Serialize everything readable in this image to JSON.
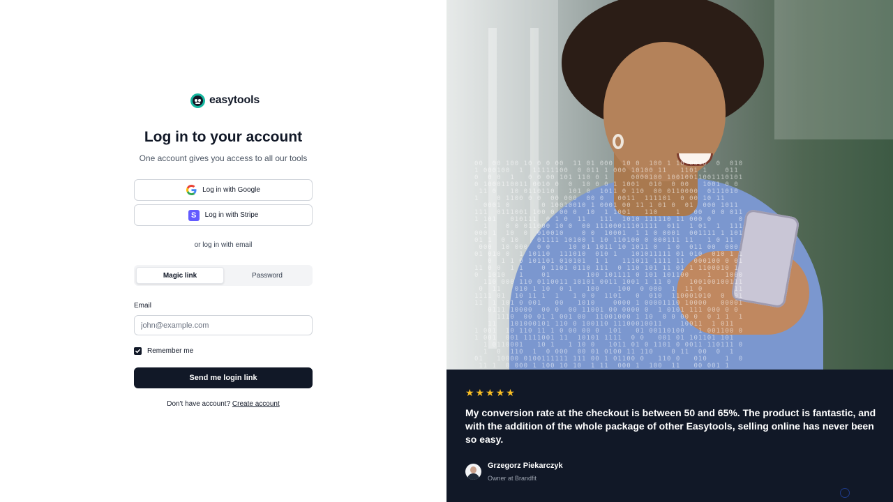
{
  "brand": {
    "name": "easytools",
    "accent": "#16b8a0"
  },
  "login": {
    "title": "Log in to your account",
    "subtitle": "One account gives you access to all our tools",
    "google_label": "Log in with Google",
    "stripe_label": "Log in with Stripe",
    "stripe_letter": "S",
    "divider": "or log in with email",
    "tabs": [
      {
        "label": "Magic link",
        "active": true
      },
      {
        "label": "Password",
        "active": false
      }
    ],
    "email_label": "Email",
    "email_placeholder": "john@example.com",
    "email_value": "",
    "remember_label": "Remember me",
    "remember_checked": true,
    "submit_label": "Send me login link",
    "signup_prompt": "Don't have account?",
    "signup_link": "Create account"
  },
  "testimonial": {
    "rating": 5,
    "star_color": "#fbbf24",
    "quote": "My conversion rate at the checkout is between 50 and 65%. The product is fantastic, and with the addition of the whole package of other Easytools, selling online has never been so easy.",
    "author_name": "Grzegorz Piekarczyk",
    "author_role": "Owner at Brandfit"
  },
  "colors": {
    "primary_button": "#111827",
    "panel_background": "#111827",
    "stripe": "#635bff"
  }
}
